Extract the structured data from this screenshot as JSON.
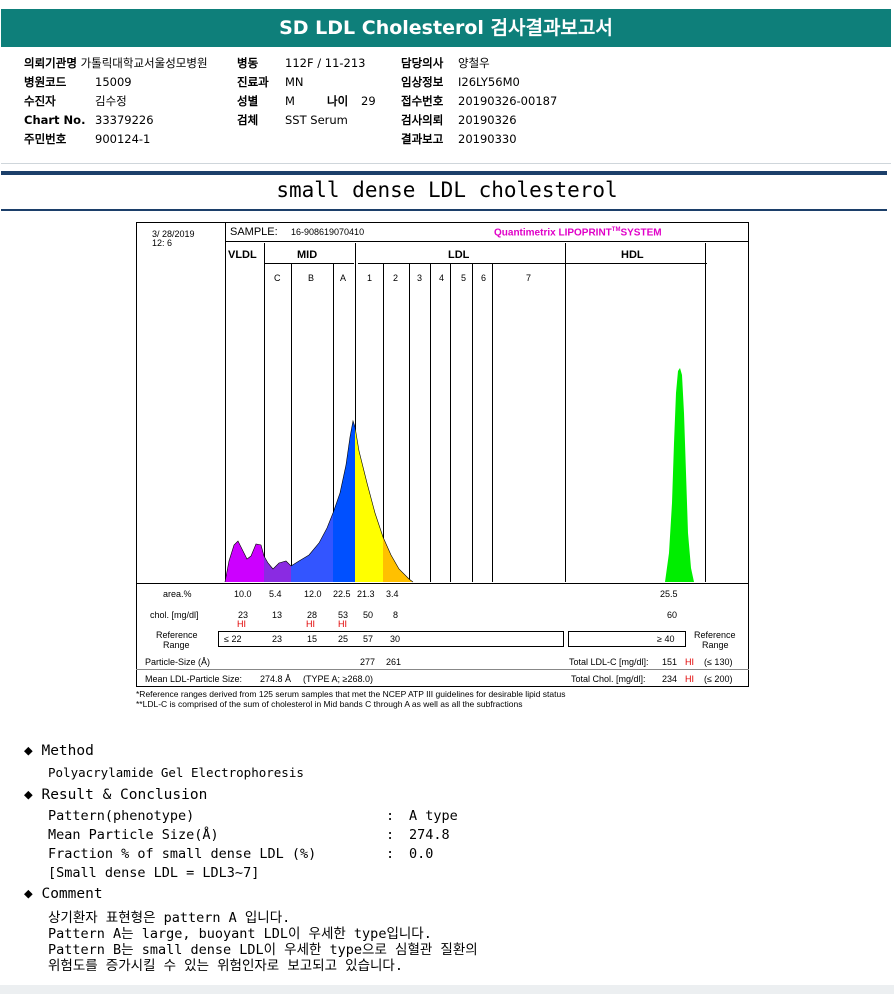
{
  "header": {
    "title": "SD LDL Cholesterol 검사결과보고서"
  },
  "patient": {
    "col1": [
      {
        "label": "의뢰기관명",
        "value": "가톨릭대학교서울성모병원"
      },
      {
        "label": "병원코드",
        "value": "15009"
      },
      {
        "label": "수진자",
        "value": "김수정"
      },
      {
        "label": "Chart No.",
        "value": "33379226"
      },
      {
        "label": "주민번호",
        "value": "900124-1"
      }
    ],
    "col2": [
      {
        "label": "병동",
        "value": "112F / 11-213"
      },
      {
        "label": "진료과",
        "value": "MN"
      },
      {
        "label": "성별",
        "value": "M"
      },
      {
        "label": "검체",
        "value": "SST Serum"
      }
    ],
    "age": {
      "label": "나이",
      "value": "29"
    },
    "col3": [
      {
        "label": "담당의사",
        "value": "양철우"
      },
      {
        "label": "임상정보",
        "value": "I26LY56M0"
      },
      {
        "label": "접수번호",
        "value": "20190326-00187"
      },
      {
        "label": "검사의뢰",
        "value": "20190326"
      },
      {
        "label": "결과보고",
        "value": "20190330"
      }
    ]
  },
  "subtitle": "small dense LDL cholesterol",
  "lipoprint": {
    "date": "3/ 28/2019",
    "time": "12: 6",
    "sample_label": "SAMPLE:",
    "sample_id": "16-908619070410",
    "brand": "Quantimetrix LIPOPRINT",
    "brand_tm": "TM",
    "brand_suffix": "SYSTEM",
    "groups": {
      "vldl": "VLDL",
      "mid": "MID",
      "ldl": "LDL",
      "hdl": "HDL"
    },
    "bands": [
      "C",
      "B",
      "A",
      "1",
      "2",
      "3",
      "4",
      "5",
      "6",
      "7"
    ],
    "area_label": "area.%",
    "area": [
      "10.0",
      "5.4",
      "12.0",
      "22.5",
      "21.3",
      "3.4"
    ],
    "hdl_area": "25.5",
    "chol_label": "chol. [mg/dl]",
    "chol": [
      "23",
      "13",
      "28",
      "53",
      "50",
      "8"
    ],
    "hdl_chol": "60",
    "hi": "HI",
    "ref_label_l1": "Reference",
    "ref_label_l2": "Range",
    "ref": [
      "≤ 22",
      "23",
      "15",
      "25",
      "57",
      "30"
    ],
    "hdl_ref": "≥ 40",
    "particle_label": "Particle-Size (Å)",
    "particle": [
      "277",
      "261"
    ],
    "mean_label": "Mean LDL-Particle Size:",
    "mean_value": "274.8 Å",
    "mean_type": "(TYPE A; ≥268.0)",
    "total_ldl_label": "Total LDL-C [mg/dl]:",
    "total_ldl_value": "151",
    "total_ldl_ref": "(≤ 130)",
    "total_chol_label": "Total Chol. [mg/dl]:",
    "total_chol_value": "234",
    "total_chol_ref": "(≤ 200)",
    "footnote1": "*Reference ranges derived from 125 serum samples that met the NCEP ATP III guidelines for desirable lipid status",
    "footnote2": "**LDL-C is comprised of the sum of cholesterol in Mid bands C through A as well as all the subfractions",
    "colors": {
      "vldl": "#cc00ff",
      "midc": "#8a2be2",
      "midb": "#3355ff",
      "mida": "#0050ff",
      "ldl1": "#ffff00",
      "ldl2": "#ffc000",
      "hdl": "#00ee00"
    }
  },
  "method": {
    "title": "Method",
    "text": "Polyacrylamide Gel Electrophoresis"
  },
  "result": {
    "title": "Result & Conclusion",
    "rows": [
      {
        "k": "Pattern(phenotype)",
        "v": "A type"
      },
      {
        "k": "Mean Particle Size(Å)",
        "v": "274.8"
      },
      {
        "k": "Fraction % of small dense LDL (%)",
        "v": "0.0"
      }
    ],
    "note": "[Small dense LDL = LDL3~7]"
  },
  "comment": {
    "title": "Comment",
    "lines": [
      "상기환자 표현형은 pattern A 입니다.",
      "Pattern A는 large, buoyant LDL이 우세한 type입니다.",
      "Pattern B는 small dense LDL이 우세한 type으로 심혈관 질환의",
      "위험도를 증가시킬 수 있는 위험인자로 보고되고 있습니다."
    ]
  }
}
